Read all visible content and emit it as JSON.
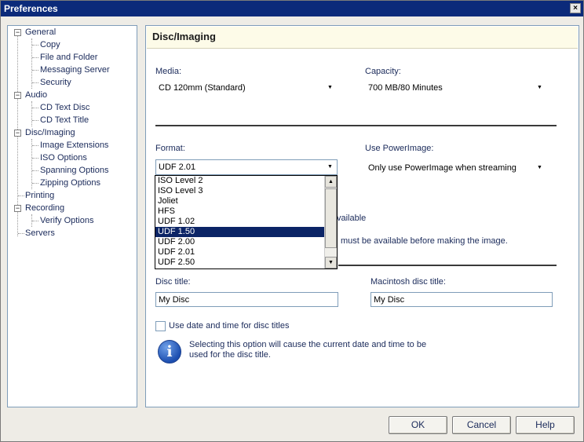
{
  "window": {
    "title": "Preferences",
    "close": "×"
  },
  "tree": {
    "general": "General",
    "copy": "Copy",
    "file_and_folder": "File and Folder",
    "messaging_server": "Messaging Server",
    "security": "Security",
    "audio": "Audio",
    "cd_text_disc": "CD Text Disc",
    "cd_text_title": "CD Text Title",
    "disc_imaging": "Disc/Imaging",
    "image_extensions": "Image Extensions",
    "iso_options": "ISO Options",
    "spanning_options": "Spanning Options",
    "zipping_options": "Zipping Options",
    "printing": "Printing",
    "recording": "Recording",
    "verify_options": "Verify Options",
    "servers": "Servers",
    "selected": "Disc/Imaging"
  },
  "panel": {
    "title": "Disc/Imaging",
    "media_label": "Media:",
    "media_value": "CD 120mm (Standard)",
    "capacity_label": "Capacity:",
    "capacity_value": "700 MB/80 Minutes",
    "format_label": "Format:",
    "format_value": "UDF 2.01",
    "powerimage_label": "Use PowerImage:",
    "powerimage_value": "Only use PowerImage when streaming",
    "hidden_text_1": "vailable",
    "hidden_text_2": "must be available before making the image.",
    "disc_title_label": "Disc title:",
    "disc_title_value": "My Disc",
    "mac_title_label": "Macintosh disc title:",
    "mac_title_value": "My Disc",
    "date_checkbox_label": "Use date and time for disc titles",
    "date_checkbox_checked": false,
    "info_text_line1": "Selecting this option will cause the current date and time to be",
    "info_text_line2": "used for the disc title."
  },
  "format_dropdown": {
    "options": [
      "ISO Level 2",
      "ISO Level 3",
      "Joliet",
      "HFS",
      "UDF 1.02",
      "UDF 1.50",
      "UDF 2.00",
      "UDF 2.01",
      "UDF 2.50"
    ],
    "highlighted": "UDF 1.50"
  },
  "buttons": {
    "ok": "OK",
    "cancel": "Cancel",
    "help": "Help"
  },
  "colors": {
    "titlebar": "#0b2a7a",
    "selection": "#0b2466",
    "header_bg": "#fdfbe8"
  }
}
